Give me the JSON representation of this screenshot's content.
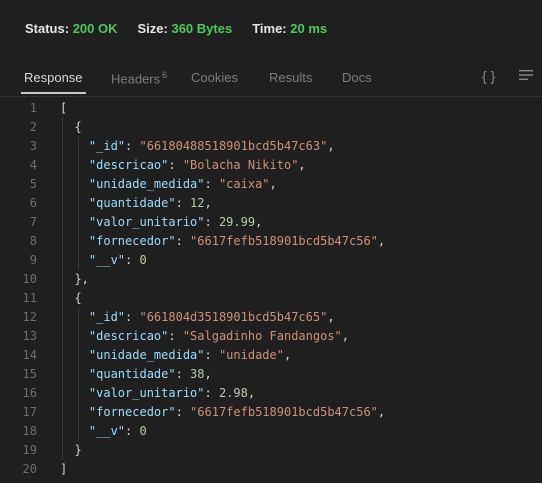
{
  "status": {
    "status_label": "Status:",
    "status_value": "200 OK",
    "size_label": "Size:",
    "size_value": "360 Bytes",
    "time_label": "Time:",
    "time_value": "20 ms"
  },
  "tabs": {
    "response": "Response",
    "headers": "Headers",
    "headers_count": "6",
    "cookies": "Cookies",
    "results": "Results",
    "docs": "Docs"
  },
  "icons": {
    "braces": "{ }",
    "menu": "menu-lines-icon"
  },
  "colors": {
    "ok": "#4ec95a",
    "key": "#9cdcfe",
    "string": "#ce9178",
    "number": "#b5cea8"
  },
  "code": {
    "lines": [
      {
        "n": "1",
        "p": [
          [
            "p",
            "["
          ]
        ]
      },
      {
        "n": "2",
        "p": [
          [
            "p",
            "  {"
          ]
        ]
      },
      {
        "n": "3",
        "p": [
          [
            "key",
            "    \"_id\""
          ],
          [
            "p",
            ": "
          ],
          [
            "str",
            "\"66180488518901bcd5b47c63\""
          ],
          [
            "p",
            ","
          ]
        ]
      },
      {
        "n": "4",
        "p": [
          [
            "key",
            "    \"descricao\""
          ],
          [
            "p",
            ": "
          ],
          [
            "str",
            "\"Bolacha Nikito\""
          ],
          [
            "p",
            ","
          ]
        ]
      },
      {
        "n": "5",
        "p": [
          [
            "key",
            "    \"unidade_medida\""
          ],
          [
            "p",
            ": "
          ],
          [
            "str",
            "\"caixa\""
          ],
          [
            "p",
            ","
          ]
        ]
      },
      {
        "n": "6",
        "p": [
          [
            "key",
            "    \"quantidade\""
          ],
          [
            "p",
            ": "
          ],
          [
            "num",
            "12"
          ],
          [
            "p",
            ","
          ]
        ]
      },
      {
        "n": "7",
        "p": [
          [
            "key",
            "    \"valor_unitario\""
          ],
          [
            "p",
            ": "
          ],
          [
            "num",
            "29.99"
          ],
          [
            "p",
            ","
          ]
        ]
      },
      {
        "n": "8",
        "p": [
          [
            "key",
            "    \"fornecedor\""
          ],
          [
            "p",
            ": "
          ],
          [
            "str",
            "\"6617fefb518901bcd5b47c56\""
          ],
          [
            "p",
            ","
          ]
        ]
      },
      {
        "n": "9",
        "p": [
          [
            "key",
            "    \"__v\""
          ],
          [
            "p",
            ": "
          ],
          [
            "num",
            "0"
          ]
        ]
      },
      {
        "n": "10",
        "p": [
          [
            "p",
            "  },"
          ]
        ]
      },
      {
        "n": "11",
        "p": [
          [
            "p",
            "  {"
          ]
        ]
      },
      {
        "n": "12",
        "p": [
          [
            "key",
            "    \"_id\""
          ],
          [
            "p",
            ": "
          ],
          [
            "str",
            "\"661804d3518901bcd5b47c65\""
          ],
          [
            "p",
            ","
          ]
        ]
      },
      {
        "n": "13",
        "p": [
          [
            "key",
            "    \"descricao\""
          ],
          [
            "p",
            ": "
          ],
          [
            "str",
            "\"Salgadinho Fandangos\""
          ],
          [
            "p",
            ","
          ]
        ]
      },
      {
        "n": "14",
        "p": [
          [
            "key",
            "    \"unidade_medida\""
          ],
          [
            "p",
            ": "
          ],
          [
            "str",
            "\"unidade\""
          ],
          [
            "p",
            ","
          ]
        ]
      },
      {
        "n": "15",
        "p": [
          [
            "key",
            "    \"quantidade\""
          ],
          [
            "p",
            ": "
          ],
          [
            "num",
            "38"
          ],
          [
            "p",
            ","
          ]
        ]
      },
      {
        "n": "16",
        "p": [
          [
            "key",
            "    \"valor_unitario\""
          ],
          [
            "p",
            ": "
          ],
          [
            "num",
            "2.98"
          ],
          [
            "p",
            ","
          ]
        ]
      },
      {
        "n": "17",
        "p": [
          [
            "key",
            "    \"fornecedor\""
          ],
          [
            "p",
            ": "
          ],
          [
            "str",
            "\"6617fefb518901bcd5b47c56\""
          ],
          [
            "p",
            ","
          ]
        ]
      },
      {
        "n": "18",
        "p": [
          [
            "key",
            "    \"__v\""
          ],
          [
            "p",
            ": "
          ],
          [
            "num",
            "0"
          ]
        ]
      },
      {
        "n": "19",
        "p": [
          [
            "p",
            "  }"
          ]
        ]
      },
      {
        "n": "20",
        "p": [
          [
            "p",
            "]"
          ]
        ]
      }
    ]
  }
}
